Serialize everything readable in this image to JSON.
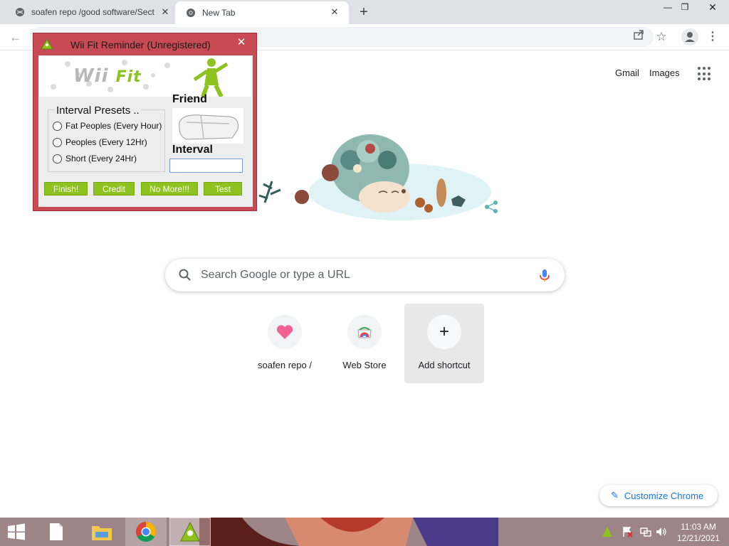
{
  "browser": {
    "tabs": [
      {
        "label": "soafen repo /good software/Sect"
      },
      {
        "label": "New Tab"
      }
    ]
  },
  "ntp": {
    "gmail": "Gmail",
    "images": "Images",
    "search_placeholder": "Search Google or type a URL",
    "shortcuts": [
      {
        "label": "soafen repo /"
      },
      {
        "label": "Web Store"
      },
      {
        "label": "Add shortcut"
      }
    ],
    "customize": "Customize Chrome"
  },
  "wii": {
    "title": "Wii Fit Reminder (Unregistered)",
    "logo_wii": "Wii",
    "logo_fit": "Fit",
    "friend_label": "Friend",
    "interval_label": "Interval",
    "interval_value": "",
    "presets_label": "Interval Presets ..",
    "presets": [
      "Fat Peoples (Every Hour)",
      "Peoples (Every 12Hr)",
      "Short (Every 24Hr)"
    ],
    "buttons": [
      "Finish!",
      "Credit",
      "No More!!!",
      "Test"
    ],
    "accent_color": "#8dc21f",
    "frame_color": "#c74a55"
  },
  "taskbar": {
    "time": "11:03 AM",
    "date": "12/21/2021"
  }
}
